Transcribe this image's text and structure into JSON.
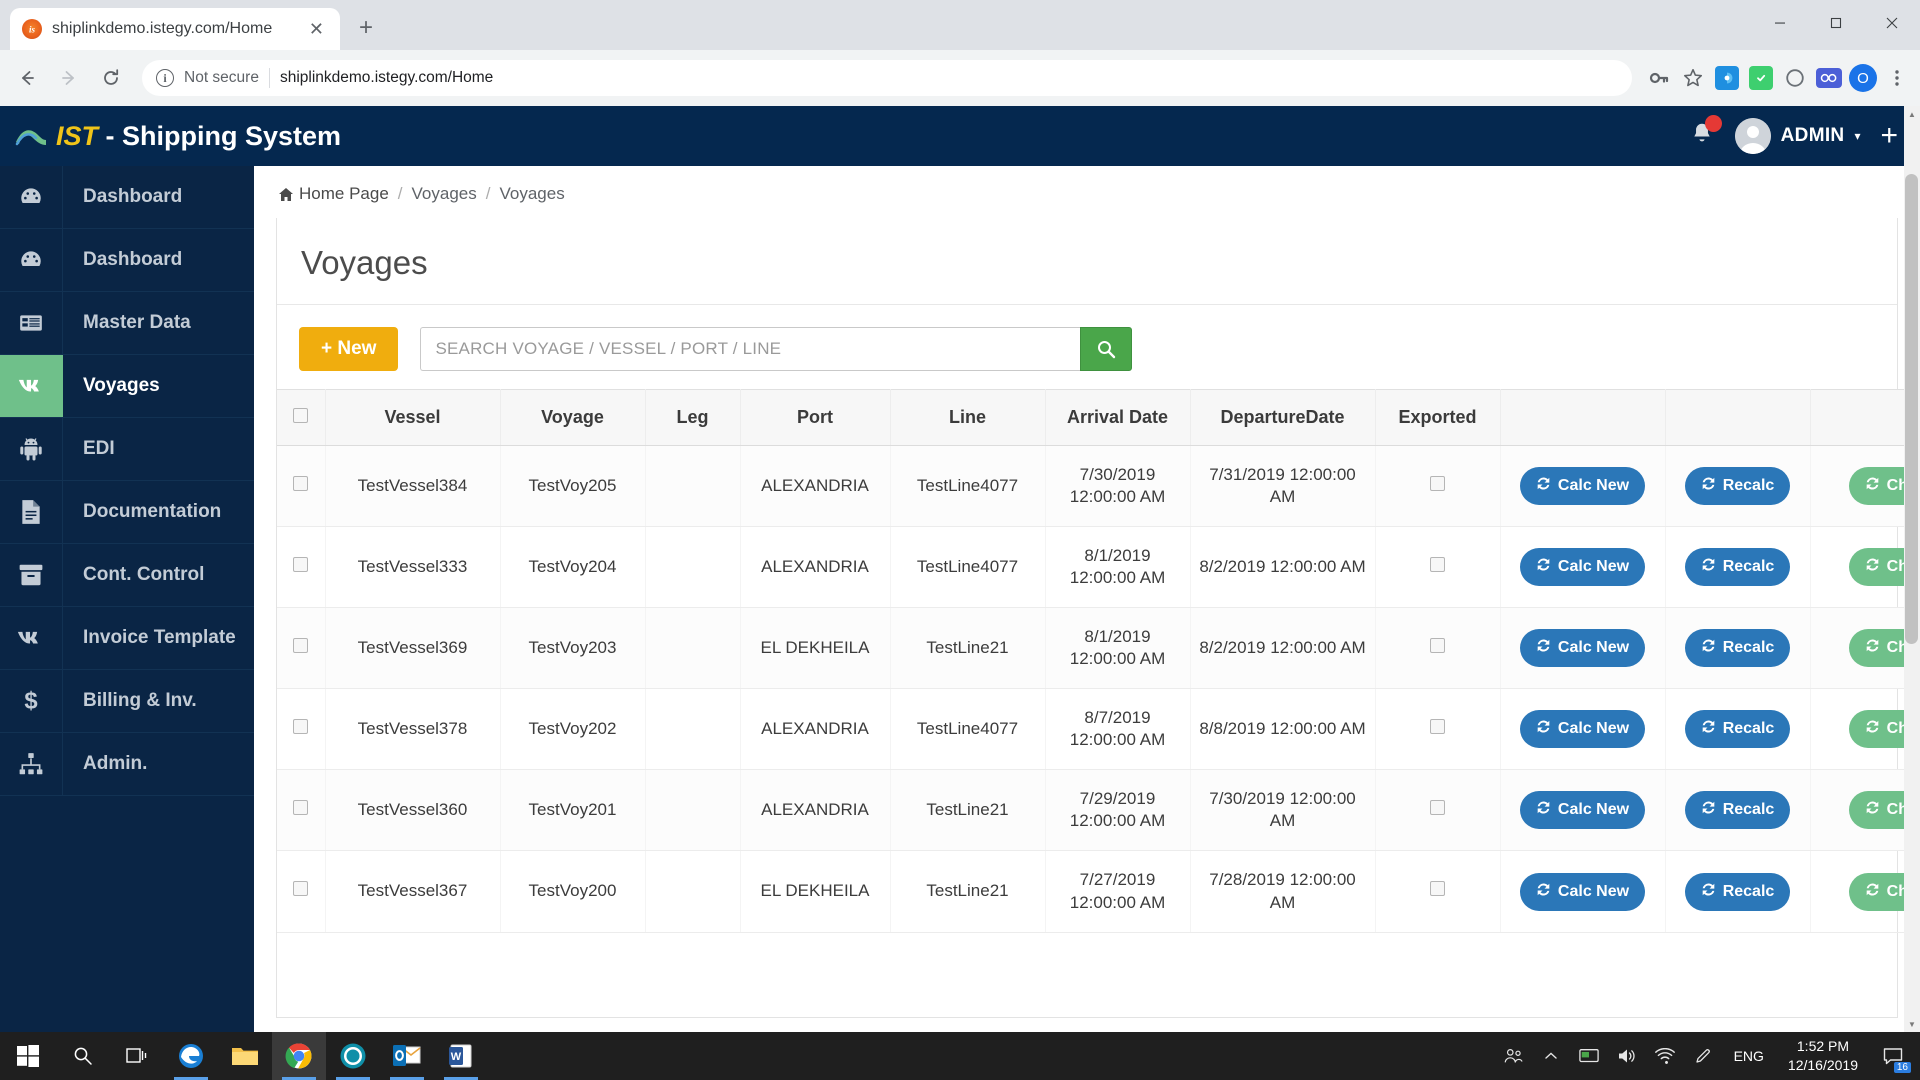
{
  "browser": {
    "tab": {
      "title": "shiplinkdemo.istegy.com/Home",
      "favicon_label": "is"
    },
    "new_tab_label": "+",
    "window_controls": {
      "minimize": "—",
      "maximize": "▢",
      "close": "✕"
    },
    "nav": {
      "back": "back-arrow",
      "forward": "forward-arrow",
      "reload": "reload-arrow"
    },
    "omnibox": {
      "security_label": "Not secure",
      "url": "shiplinkdemo.istegy.com/Home",
      "info_glyph": "i"
    },
    "toolbar_icons": [
      "key-icon",
      "star-icon",
      "extension-blue-icon",
      "extension-green-icon",
      "extension-circle-icon",
      "extension-infinity-icon"
    ],
    "profile_initial": "O",
    "menu_label": "⋮"
  },
  "app": {
    "brand_prefix": "IST",
    "brand_suffix": " - Shipping System",
    "notification_count": "",
    "user_name": "ADMIN",
    "caret": "▾",
    "add_label": "+"
  },
  "sidebar": {
    "items": [
      {
        "label": "Dashboard",
        "icon": "dashboard-icon",
        "active": false
      },
      {
        "label": "Dashboard",
        "icon": "dashboard-icon",
        "active": false
      },
      {
        "label": "Master Data",
        "icon": "table-icon",
        "active": false
      },
      {
        "label": "Voyages",
        "icon": "vk-icon",
        "active": true
      },
      {
        "label": "EDI",
        "icon": "android-icon",
        "active": false
      },
      {
        "label": "Documentation",
        "icon": "file-text-icon",
        "active": false
      },
      {
        "label": "Cont. Control",
        "icon": "archive-icon",
        "active": false
      },
      {
        "label": "Invoice Template",
        "icon": "vk-icon",
        "active": false
      },
      {
        "label": "Billing & Inv.",
        "icon": "dollar-icon",
        "active": false
      },
      {
        "label": "Admin.",
        "icon": "sitemap-icon",
        "active": false
      }
    ]
  },
  "breadcrumb": {
    "home": "Home Page",
    "items": [
      "Voyages",
      "Voyages"
    ],
    "separator": "/"
  },
  "main": {
    "title": "Voyages",
    "new_button": "New",
    "new_button_plus": "+",
    "search": {
      "placeholder": "SEARCH VOYAGE / VESSEL / PORT / LINE",
      "value": ""
    },
    "table": {
      "columns": [
        "",
        "Vessel",
        "Voyage",
        "Leg",
        "Port",
        "Line",
        "Arrival Date",
        "DepartureDate",
        "Exported",
        "",
        "",
        ""
      ],
      "rows": [
        {
          "vessel": "TestVessel384",
          "voyage": "TestVoy205",
          "leg": "",
          "port": "ALEXANDRIA",
          "line": "TestLine4077",
          "arrival": "7/30/2019 12:00:00 AM",
          "departure": "7/31/2019 12:00:00 AM",
          "calc": "Calc New",
          "recalc": "Recalc",
          "change": "Change"
        },
        {
          "vessel": "TestVessel333",
          "voyage": "TestVoy204",
          "leg": "",
          "port": "ALEXANDRIA",
          "line": "TestLine4077",
          "arrival": "8/1/2019 12:00:00 AM",
          "departure": "8/2/2019 12:00:00 AM",
          "calc": "Calc New",
          "recalc": "Recalc",
          "change": "Change"
        },
        {
          "vessel": "TestVessel369",
          "voyage": "TestVoy203",
          "leg": "",
          "port": "EL DEKHEILA",
          "line": "TestLine21",
          "arrival": "8/1/2019 12:00:00 AM",
          "departure": "8/2/2019 12:00:00 AM",
          "calc": "Calc New",
          "recalc": "Recalc",
          "change": "Change"
        },
        {
          "vessel": "TestVessel378",
          "voyage": "TestVoy202",
          "leg": "",
          "port": "ALEXANDRIA",
          "line": "TestLine4077",
          "arrival": "8/7/2019 12:00:00 AM",
          "departure": "8/8/2019 12:00:00 AM",
          "calc": "Calc New",
          "recalc": "Recalc",
          "change": "Change"
        },
        {
          "vessel": "TestVessel360",
          "voyage": "TestVoy201",
          "leg": "",
          "port": "ALEXANDRIA",
          "line": "TestLine21",
          "arrival": "7/29/2019 12:00:00 AM",
          "departure": "7/30/2019 12:00:00 AM",
          "calc": "Calc New",
          "recalc": "Recalc",
          "change": "Change"
        },
        {
          "vessel": "TestVessel367",
          "voyage": "TestVoy200",
          "leg": "",
          "port": "EL DEKHEILA",
          "line": "TestLine21",
          "arrival": "7/27/2019 12:00:00 AM",
          "departure": "7/28/2019 12:00:00 AM",
          "calc": "Calc New",
          "recalc": "Recalc",
          "change": "Change"
        }
      ]
    }
  },
  "taskbar": {
    "start": "windows-icon",
    "search": "search-icon",
    "taskview": "task-view-icon",
    "apps": [
      "edge-icon",
      "file-explorer-icon",
      "chrome-icon",
      "teams-icon",
      "outlook-icon",
      "word-icon"
    ],
    "tray": {
      "people": "people-icon",
      "chevron": "chevron-up-icon",
      "monitor": "monitor-icon",
      "volume": "volume-icon",
      "network": "network-icon",
      "pen": "pen-icon",
      "language": "ENG",
      "time": "1:52 PM",
      "date": "12/16/2019",
      "notification_count": "16"
    }
  },
  "colors": {
    "header_navy": "#05284f",
    "sidebar_navy": "#0a2545",
    "accent_green": "#6fc08a",
    "accent_yellow": "#f0ad0e",
    "button_blue": "#2b77b8",
    "brand_yellow": "#f0c419"
  }
}
